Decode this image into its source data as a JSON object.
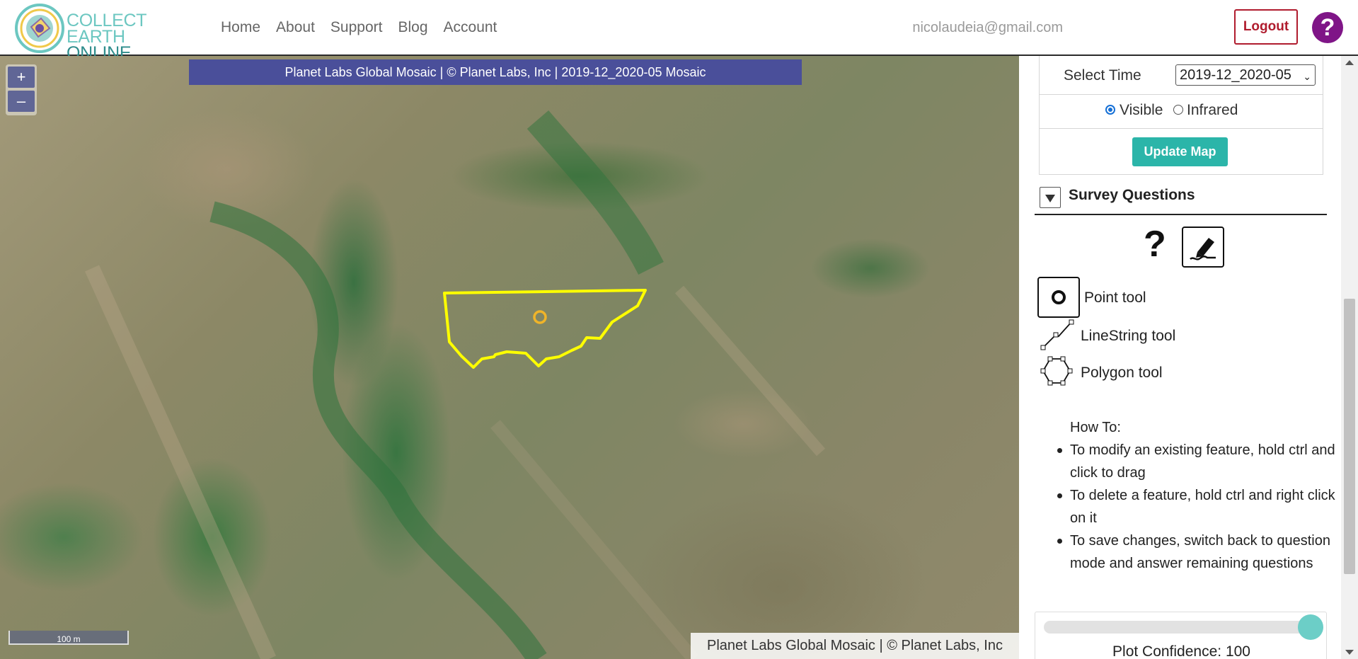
{
  "app": {
    "logo_line1": "COLLECT EARTH",
    "logo_line2": "ONLINE"
  },
  "nav": {
    "items": [
      {
        "label": "Home"
      },
      {
        "label": "About"
      },
      {
        "label": "Support"
      },
      {
        "label": "Blog"
      },
      {
        "label": "Account"
      }
    ],
    "user_email": "nicolaudeia@gmail.com",
    "logout_label": "Logout",
    "help_label": "?"
  },
  "map": {
    "attribution_top": "Planet Labs Global Mosaic | © Planet Labs, Inc | 2019-12_2020-05 Mosaic",
    "attribution_bottom": "Planet Labs Global Mosaic | © Planet Labs, Inc",
    "zoom_in_label": "+",
    "zoom_out_label": "–",
    "scale_label": "100 m",
    "feature_color": "#ffff00",
    "plot_center_color": "#f0b429"
  },
  "imagery": {
    "select_time_label": "Select Time",
    "selected_time": "2019-12_2020-05",
    "band_options": [
      {
        "label": "Visible",
        "checked": true
      },
      {
        "label": "Infrared",
        "checked": false
      }
    ],
    "update_button_label": "Update Map"
  },
  "survey": {
    "title": "Survey Questions",
    "help_symbol": "?",
    "tools": [
      {
        "label": "Point tool",
        "icon": "point-icon"
      },
      {
        "label": "LineString tool",
        "icon": "linestring-icon"
      },
      {
        "label": "Polygon tool",
        "icon": "polygon-icon"
      }
    ],
    "howto_title": "How To:",
    "howto_items": [
      "To modify an existing feature, hold ctrl and click to drag",
      "To delete a feature, hold ctrl and right click on it",
      "To save changes, switch back to question mode and answer remaining questions"
    ],
    "plot_confidence_label": "Plot Confidence: 100",
    "plot_confidence_value": 100
  },
  "colors": {
    "accent": "#2bb5a9",
    "logout": "#b01c2e",
    "help": "#7f1587",
    "attribution_bar": "#4a4f9a"
  }
}
